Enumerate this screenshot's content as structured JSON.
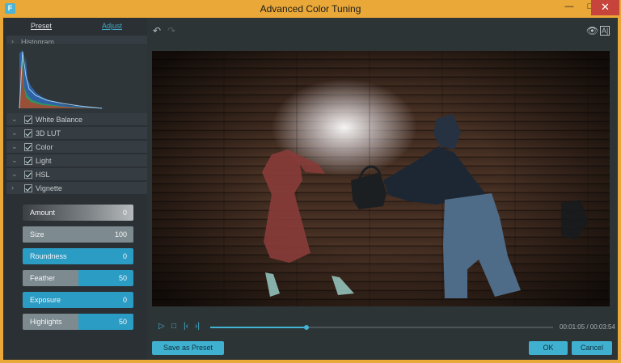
{
  "window": {
    "title": "Advanced Color Tuning",
    "app_icon": "F"
  },
  "titlebar_buttons": {
    "minimize": "—",
    "maximize": "□",
    "close": "✕"
  },
  "panel": {
    "tabs": {
      "preset": "Preset",
      "adjust": "Adjust",
      "active": "Adjust"
    },
    "histogram_label": "Histogram",
    "sections": [
      {
        "label": "White Balance",
        "checked": true
      },
      {
        "label": "3D LUT",
        "checked": true
      },
      {
        "label": "Color",
        "checked": true
      },
      {
        "label": "Light",
        "checked": true
      },
      {
        "label": "HSL",
        "checked": true
      },
      {
        "label": "Vignette",
        "checked": true
      }
    ],
    "sliders": [
      {
        "name": "Amount",
        "value": "0",
        "level": 0
      },
      {
        "name": "Size",
        "value": "100",
        "level": 1.0
      },
      {
        "name": "Roundness",
        "value": "0",
        "level": 0
      },
      {
        "name": "Feather",
        "value": "50",
        "level": 0.5
      },
      {
        "name": "Exposure",
        "value": "0",
        "level": 0
      },
      {
        "name": "Highlights",
        "value": "50",
        "level": 0.5
      }
    ]
  },
  "player": {
    "current_time": "00:01:05",
    "total_time": "00:03:54",
    "time_display": "00:01:05 / 00:03:54",
    "progress": 0.28
  },
  "buttons": {
    "save_preset": "Save as Preset",
    "ok": "OK",
    "cancel": "Cancel"
  },
  "icons": {
    "undo": "undo-icon",
    "redo": "redo-icon",
    "eye": "eye-icon",
    "compare": "compare-icon",
    "play": "play-icon",
    "stop": "stop-icon",
    "prev": "prev-frame-icon",
    "next": "next-frame-icon"
  },
  "colors": {
    "accent": "#3fb0cf",
    "title_bar": "#e9a838",
    "close": "#c7443c",
    "panel": "#2a3034"
  }
}
